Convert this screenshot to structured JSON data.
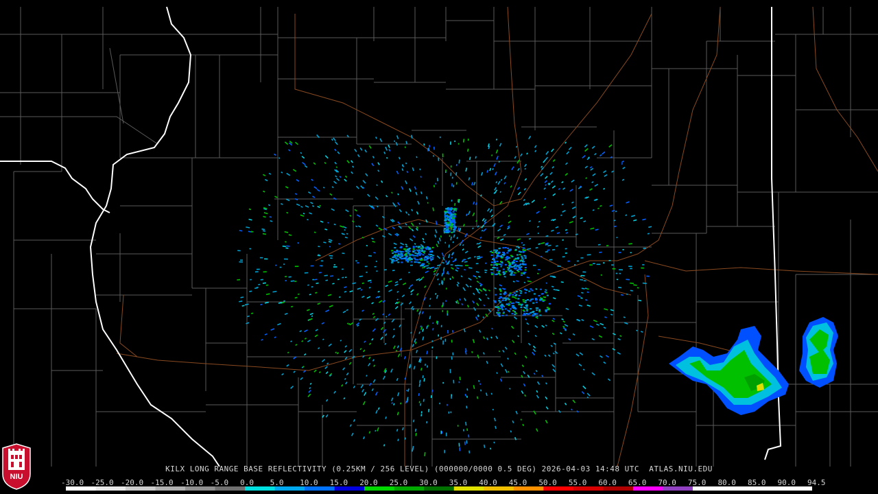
{
  "caption": {
    "site": "KILX",
    "product": "LONG RANGE BASE REFLECTIVITY",
    "resolution": "(0.25KM / 256 LEVEL)",
    "volume": "(000000/0000 0.5 DEG)",
    "date": "2026-04-03",
    "time": "14:48 UTC",
    "source": "ATLAS.NIU.EDU"
  },
  "logo": {
    "text": "NIU",
    "colors": {
      "shield": "#c8102e",
      "tower": "#ffffff"
    }
  },
  "color_scale": {
    "labels": [
      "-30.0",
      "-25.0",
      "-20.0",
      "-15.0",
      "-10.0",
      "-5.0",
      "0.0",
      "5.0",
      "10.0",
      "15.0",
      "20.0",
      "25.0",
      "30.0",
      "35.0",
      "40.0",
      "45.0",
      "50.0",
      "55.0",
      "60.0",
      "65.0",
      "70.0",
      "75.0",
      "80.0",
      "85.0",
      "90.0",
      "94.5"
    ],
    "stops": [
      "#ffffff",
      "#e8e8e8",
      "#cccccc",
      "#b0b0b0",
      "#909090",
      "#707070",
      "#00e0e0",
      "#00a8f0",
      "#0070ff",
      "#0000e0",
      "#00d800",
      "#00a800",
      "#007000",
      "#e0e000",
      "#f0c000",
      "#ff9000",
      "#ff0000",
      "#d80000",
      "#b00000",
      "#ff00ff",
      "#9040c0",
      "#ffffff",
      "#ffffff",
      "#ffffff",
      "#ffffff",
      "#ffffff"
    ]
  },
  "map_colors": {
    "background": "#000000",
    "county_lines": "#5a5a5a",
    "state_lines": "#ffffff",
    "highways": "#8a4a20",
    "echo_light": "#00a0d0",
    "echo_mid": "#0060ff",
    "echo_green": "#00c000",
    "echo_yellow": "#e0e000"
  }
}
